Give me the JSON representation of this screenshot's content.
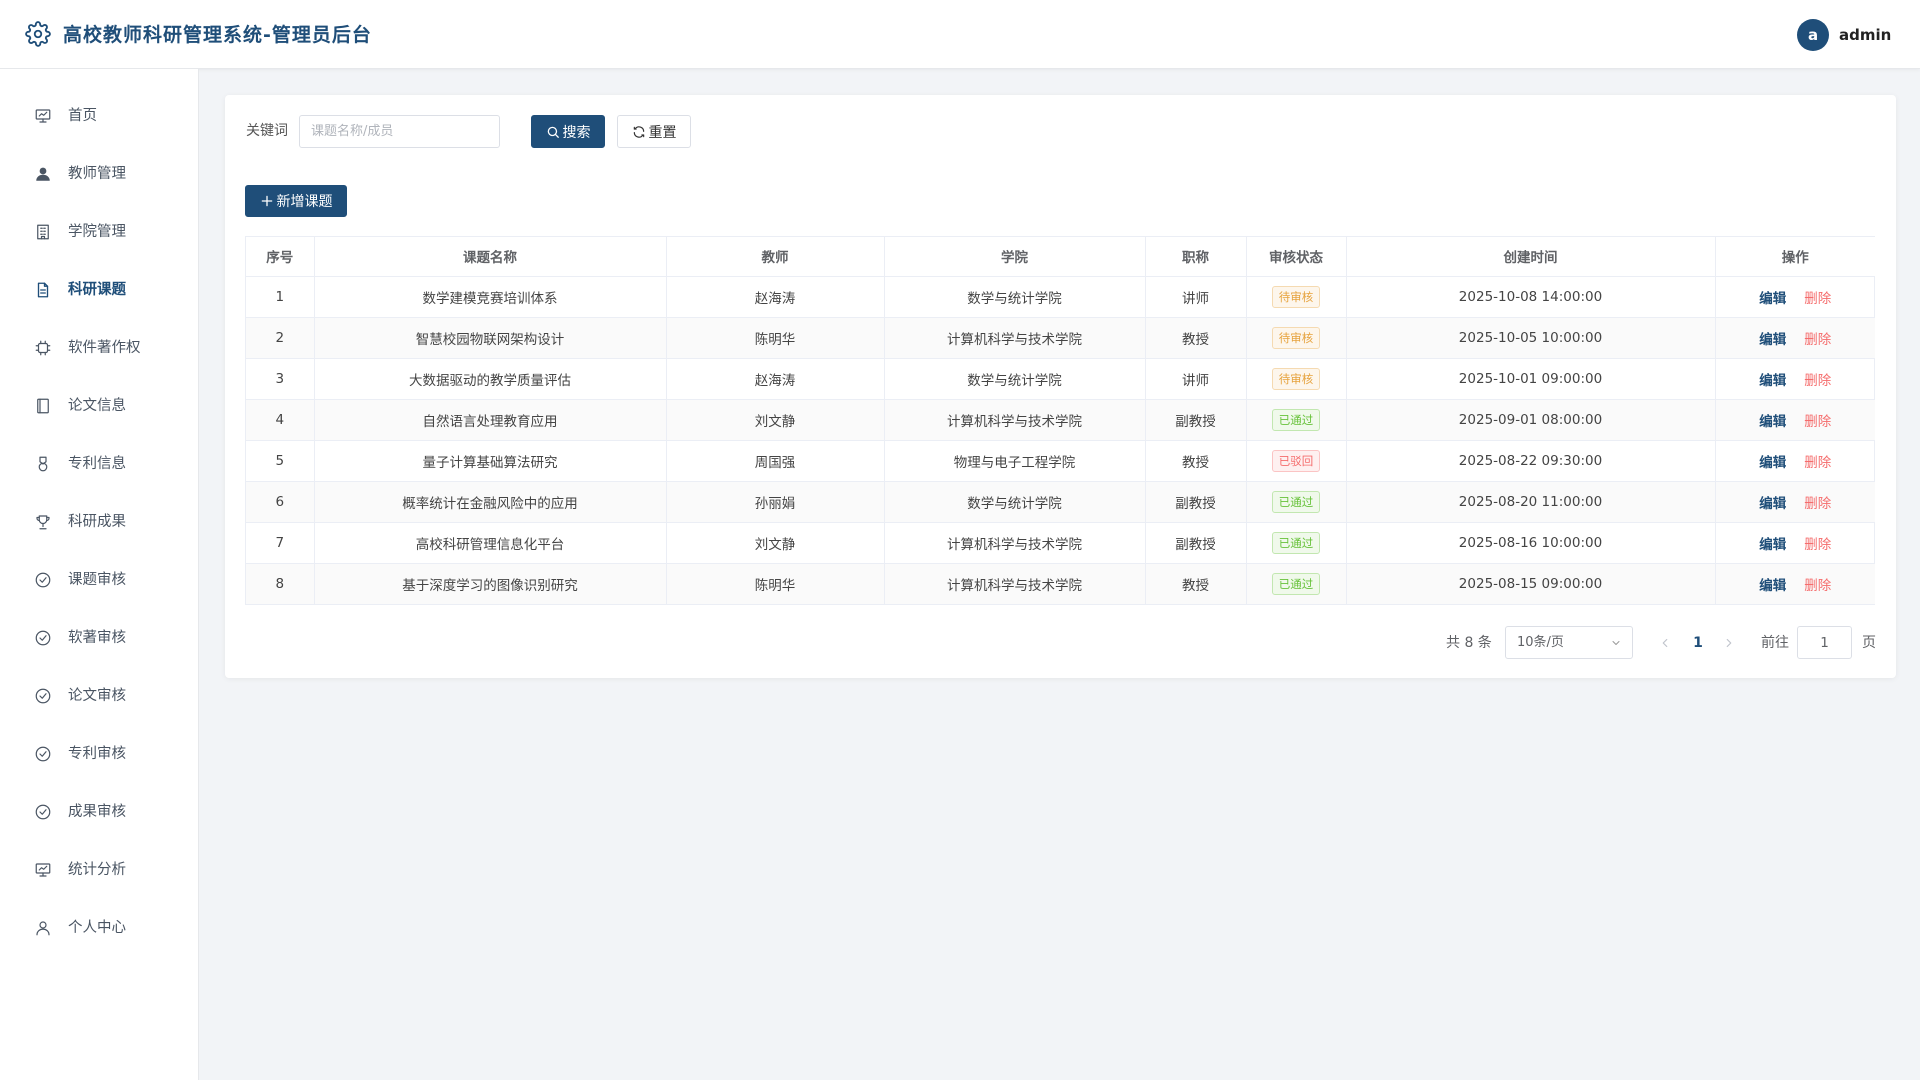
{
  "header": {
    "title": "高校教师科研管理系统-管理员后台",
    "logo_icon": "gear-icon",
    "avatar_letter": "a",
    "username": "admin"
  },
  "sidebar": {
    "items": [
      {
        "label": "首页",
        "icon": "presentation-icon",
        "active": false
      },
      {
        "label": "教师管理",
        "icon": "user-filled-icon",
        "active": false
      },
      {
        "label": "学院管理",
        "icon": "building-icon",
        "active": false
      },
      {
        "label": "科研课题",
        "icon": "document-icon",
        "active": true
      },
      {
        "label": "软件著作权",
        "icon": "chip-icon",
        "active": false
      },
      {
        "label": "论文信息",
        "icon": "notebook-icon",
        "active": false
      },
      {
        "label": "专利信息",
        "icon": "medal-icon",
        "active": false
      },
      {
        "label": "科研成果",
        "icon": "trophy-icon",
        "active": false
      },
      {
        "label": "课题审核",
        "icon": "check-circle-icon",
        "active": false
      },
      {
        "label": "软著审核",
        "icon": "check-circle-icon",
        "active": false
      },
      {
        "label": "论文审核",
        "icon": "check-circle-icon",
        "active": false
      },
      {
        "label": "专利审核",
        "icon": "check-circle-icon",
        "active": false
      },
      {
        "label": "成果审核",
        "icon": "check-circle-icon",
        "active": false
      },
      {
        "label": "统计分析",
        "icon": "presentation-icon",
        "active": false
      },
      {
        "label": "个人中心",
        "icon": "user-icon",
        "active": false
      }
    ]
  },
  "search": {
    "label": "关键词",
    "placeholder": "课题名称/成员",
    "value": "",
    "search_button": "搜索",
    "reset_button": "重置"
  },
  "toolbar": {
    "add_button": "新增课题"
  },
  "table": {
    "columns": [
      "序号",
      "课题名称",
      "教师",
      "学院",
      "职称",
      "审核状态",
      "创建时间",
      "操作"
    ],
    "edit_label": "编辑",
    "delete_label": "删除",
    "rows": [
      {
        "no": "1",
        "name": "数学建模竞赛培训体系",
        "teacher": "赵海涛",
        "college": "数学与统计学院",
        "title": "讲师",
        "status": "待审核",
        "status_type": "pending",
        "created": "2025-10-08 14:00:00"
      },
      {
        "no": "2",
        "name": "智慧校园物联网架构设计",
        "teacher": "陈明华",
        "college": "计算机科学与技术学院",
        "title": "教授",
        "status": "待审核",
        "status_type": "pending",
        "created": "2025-10-05 10:00:00"
      },
      {
        "no": "3",
        "name": "大数据驱动的教学质量评估",
        "teacher": "赵海涛",
        "college": "数学与统计学院",
        "title": "讲师",
        "status": "待审核",
        "status_type": "pending",
        "created": "2025-10-01 09:00:00"
      },
      {
        "no": "4",
        "name": "自然语言处理教育应用",
        "teacher": "刘文静",
        "college": "计算机科学与技术学院",
        "title": "副教授",
        "status": "已通过",
        "status_type": "approved",
        "created": "2025-09-01 08:00:00"
      },
      {
        "no": "5",
        "name": "量子计算基础算法研究",
        "teacher": "周国强",
        "college": "物理与电子工程学院",
        "title": "教授",
        "status": "已驳回",
        "status_type": "rejected",
        "created": "2025-08-22 09:30:00"
      },
      {
        "no": "6",
        "name": "概率统计在金融风险中的应用",
        "teacher": "孙丽娟",
        "college": "数学与统计学院",
        "title": "副教授",
        "status": "已通过",
        "status_type": "approved",
        "created": "2025-08-20 11:00:00"
      },
      {
        "no": "7",
        "name": "高校科研管理信息化平台",
        "teacher": "刘文静",
        "college": "计算机科学与技术学院",
        "title": "副教授",
        "status": "已通过",
        "status_type": "approved",
        "created": "2025-08-16 10:00:00"
      },
      {
        "no": "8",
        "name": "基于深度学习的图像识别研究",
        "teacher": "陈明华",
        "college": "计算机科学与技术学院",
        "title": "教授",
        "status": "已通过",
        "status_type": "approved",
        "created": "2025-08-15 09:00:00"
      }
    ]
  },
  "pagination": {
    "total_text": "共 8 条",
    "page_size": "10条/页",
    "current_page": "1",
    "goto_label": "前往",
    "goto_value": "1",
    "page_suffix": "页"
  },
  "colors": {
    "brand": "#1f4e79",
    "pending": "#e6a23c",
    "approved": "#67c23a",
    "rejected": "#f56c6c"
  }
}
